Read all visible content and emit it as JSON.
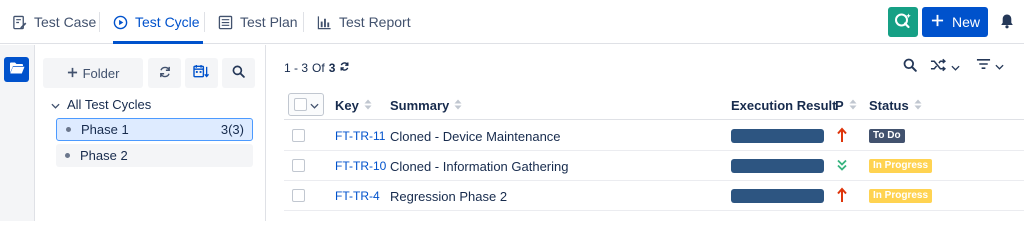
{
  "tabs": [
    {
      "label": "Test Case",
      "icon": "edit-document-icon",
      "active": false
    },
    {
      "label": "Test Cycle",
      "icon": "play-circle-icon",
      "active": true
    },
    {
      "label": "Test Plan",
      "icon": "list-document-icon",
      "active": false
    },
    {
      "label": "Test Report",
      "icon": "bar-chart-icon",
      "active": false
    }
  ],
  "header": {
    "new_label": "New",
    "quick_icon": "quick-search-icon",
    "bell_icon": "bell-icon"
  },
  "tree": {
    "folder_label": "Folder",
    "root_label": "All Test Cycles",
    "nodes": [
      {
        "label": "Phase 1",
        "count": "3(3)",
        "selected": true
      },
      {
        "label": "Phase 2",
        "count": "",
        "selected": false
      }
    ]
  },
  "pager": {
    "range": "1 - 3",
    "of": "Of",
    "total": "3"
  },
  "table": {
    "headers": {
      "key": "Key",
      "summary": "Summary",
      "execution": "Execution Result",
      "priority": "P",
      "status": "Status"
    },
    "rows": [
      {
        "key": "FT-TR-11",
        "summary": "Cloned - Device Maintenance",
        "priority": "high",
        "status": "To Do"
      },
      {
        "key": "FT-TR-10",
        "summary": "Cloned - Information Gathering",
        "priority": "low",
        "status": "In Progress"
      },
      {
        "key": "FT-TR-4",
        "summary": "Regression Phase 2",
        "priority": "high",
        "status": "In Progress"
      }
    ]
  },
  "colors": {
    "accent": "#0052cc",
    "quick_button": "#16a085",
    "todo_badge": "#42526e",
    "inprogress_badge": "#ffd351",
    "execution_bar": "#2d5581",
    "priority_high": "#de350b",
    "priority_low": "#36b37e"
  }
}
